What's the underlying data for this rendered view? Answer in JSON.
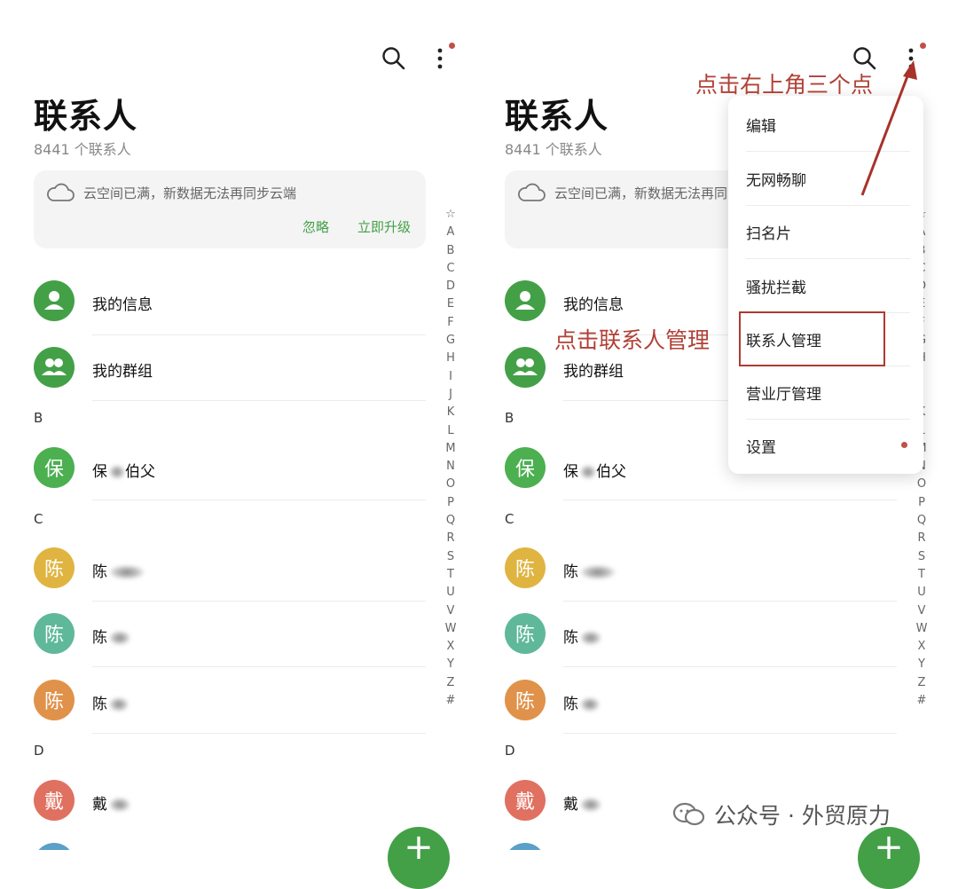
{
  "screens": [
    {
      "id": "left",
      "title": "联系人",
      "contact_count": "8441 个联系人",
      "cloud": {
        "text": "云空间已满，新数据无法再同步云端",
        "ignore_label": "忽略",
        "upgrade_label": "立即升级"
      },
      "items": {
        "my_info": {
          "avatar_icon": "person-icon",
          "label": "我的信息"
        },
        "my_groups": {
          "avatar_icon": "group-icon",
          "label": "我的群组"
        }
      },
      "sections": [
        {
          "letter": "B",
          "contacts": [
            {
              "initial": "保",
              "name_visible": "保",
              "name_tail": "伯父",
              "color": "#4caf50"
            }
          ]
        },
        {
          "letter": "C",
          "contacts": [
            {
              "initial": "陈",
              "name_visible": "陈",
              "color": "#e0b440"
            },
            {
              "initial": "陈",
              "name_visible": "陈",
              "color": "#5fb89a"
            },
            {
              "initial": "陈",
              "name_visible": "陈",
              "color": "#e0924a"
            }
          ]
        },
        {
          "letter": "D",
          "contacts": [
            {
              "initial": "戴",
              "name_visible": "戴",
              "color": "#e07060"
            }
          ]
        }
      ]
    },
    {
      "id": "right",
      "title": "联系人",
      "contact_count": "8441 个联系人",
      "cloud": {
        "text": "云空间已满，新数据无法再同步云端"
      },
      "items": {
        "my_info": {
          "avatar_icon": "person-icon",
          "label": "我的信息"
        },
        "my_groups": {
          "avatar_icon": "group-icon",
          "label": "我的群组"
        }
      },
      "sections": [
        {
          "letter": "B",
          "contacts": [
            {
              "initial": "保",
              "name_visible": "保",
              "name_tail": "伯父",
              "color": "#4caf50"
            }
          ]
        },
        {
          "letter": "C",
          "contacts": [
            {
              "initial": "陈",
              "name_visible": "陈",
              "color": "#e0b440"
            },
            {
              "initial": "陈",
              "name_visible": "陈",
              "color": "#5fb89a"
            },
            {
              "initial": "陈",
              "name_visible": "陈",
              "color": "#e0924a"
            }
          ]
        },
        {
          "letter": "D",
          "contacts": [
            {
              "initial": "戴",
              "name_visible": "戴",
              "color": "#e07060"
            }
          ]
        }
      ],
      "menu": {
        "items": [
          "编辑",
          "无网畅聊",
          "扫名片",
          "骚扰拦截",
          "联系人管理",
          "营业厅管理",
          "设置"
        ],
        "highlighted": "联系人管理"
      }
    }
  ],
  "alphabet_index": [
    "☆",
    "A",
    "B",
    "C",
    "D",
    "E",
    "F",
    "G",
    "H",
    "I",
    "J",
    "K",
    "L",
    "M",
    "N",
    "O",
    "P",
    "Q",
    "R",
    "S",
    "T",
    "U",
    "V",
    "W",
    "X",
    "Y",
    "Z",
    "#"
  ],
  "annotations": {
    "top": "点击右上角三个点",
    "middle": "点击联系人管理"
  },
  "watermark": "公众号 · 外贸原力",
  "colors": {
    "accent": "#43a047",
    "annotation": "#b04035",
    "badge": "#c0504a"
  }
}
